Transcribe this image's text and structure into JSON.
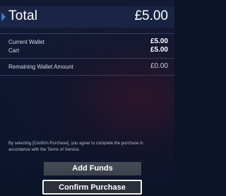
{
  "total": {
    "label": "Total",
    "amount": "£5.00"
  },
  "summary": {
    "current_wallet_label": "Current Wallet",
    "current_wallet_value": "£5.00",
    "cart_label": "Cart",
    "cart_value": "£5.00",
    "remaining_label": "Remaining Wallet Amount",
    "remaining_value": "£0.00"
  },
  "disclaimer": "By selecting [Confirm Purchase], you agree to complete the purchase in accordance with the Terms of Service.",
  "buttons": {
    "add_funds": "Add Funds",
    "confirm_purchase": "Confirm Purchase"
  },
  "icons": {
    "selection_arrow": "triangle-right-icon"
  },
  "colors": {
    "selection_accent": "#3d7cc9",
    "background": "#0d1326"
  }
}
